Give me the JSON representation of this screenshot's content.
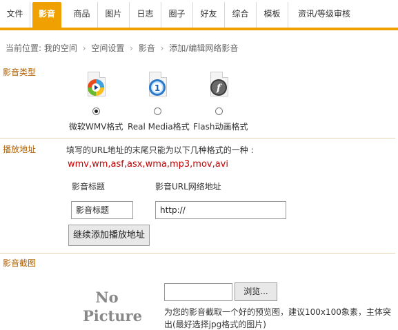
{
  "tabs": [
    "文件",
    "影音",
    "商品",
    "图片",
    "日志",
    "圈子",
    "好友",
    "综合",
    "模板",
    "资讯/等级审核"
  ],
  "breadcrumb": [
    "当前位置: 我的空间",
    "空间设置",
    "影音",
    "添加/编辑网络影音"
  ],
  "type_section": {
    "label": "影音类型",
    "formats": [
      {
        "label": "微软WMV格式",
        "icon": "windows-media-icon",
        "selected": true
      },
      {
        "label": "Real Media格式",
        "icon": "realplayer-icon",
        "selected": false
      },
      {
        "label": "Flash动画格式",
        "icon": "flash-icon",
        "selected": false
      }
    ]
  },
  "url_section": {
    "label": "播放地址",
    "hint": "填写的URL地址的末尾只能为以下几种格式的一种 :",
    "extensions": "wmv,wm,asf,asx,wma,mp3,mov,avi",
    "col_title": "影音标题",
    "col_url": "影音URL网络地址",
    "title_value": "影音标题",
    "url_value": "http://",
    "add_button": "继续添加播放地址"
  },
  "shot_section": {
    "label": "影音截图",
    "placeholder_line1": "No",
    "placeholder_line2": "Picture",
    "browse_button": "浏览...",
    "hint_line1": "为您的影音截取一个好的预览图，建议100x100象素，主体突",
    "hint_line2": "出(最好选择jpg格式的图片)"
  },
  "colors": {
    "accent": "#f0a000",
    "label": "#b06000",
    "ext": "#c00000"
  }
}
